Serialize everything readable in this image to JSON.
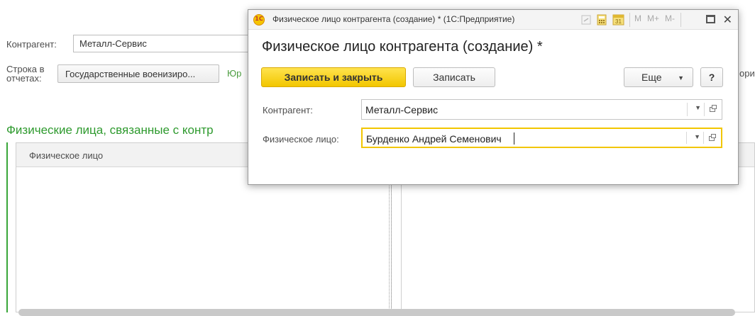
{
  "background": {
    "counterparty_label": "Контрагент:",
    "counterparty_value": "Металл-Сервис",
    "report_row_label_1": "Строка в",
    "report_row_label_2": "отчетах:",
    "report_row_value": "Государственные военизиро...",
    "legal_link_fragment": "Юр",
    "right_fragment": "ори",
    "group_title": "Физические лица, связанные с контр",
    "table": {
      "columns": [
        "Физическое лицо"
      ]
    }
  },
  "modal": {
    "window_title": "Физическое лицо контрагента (создание) * (1С:Предприятие)",
    "app_logo_text": "1С",
    "toolbar_icons": [
      "М",
      "М+",
      "М-"
    ],
    "form_title": "Физическое лицо контрагента (создание) *",
    "buttons": {
      "save_close": "Записать и закрыть",
      "save": "Записать",
      "more": "Еще",
      "help": "?"
    },
    "fields": {
      "counterparty": {
        "label": "Контрагент:",
        "value": "Металл-Сервис"
      },
      "individual": {
        "label": "Физическое лицо:",
        "value": "Бурденко Андрей Семенович"
      }
    }
  },
  "colors": {
    "accent_yellow": "#f2c600",
    "group_green": "#2e9a2e"
  }
}
